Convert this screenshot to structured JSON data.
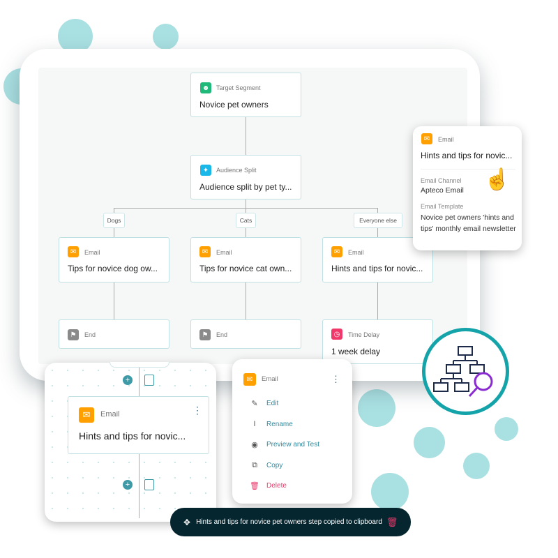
{
  "flow": {
    "target_segment": {
      "type": "Target Segment",
      "title": "Novice pet owners"
    },
    "audience_split": {
      "type": "Audience Split",
      "title": "Audience split by pet ty..."
    },
    "branches": [
      {
        "label": "Dogs",
        "email": {
          "type": "Email",
          "title": "Tips for novice dog ow..."
        },
        "next": {
          "type": "End",
          "title": ""
        }
      },
      {
        "label": "Cats",
        "email": {
          "type": "Email",
          "title": "Tips for novice cat own..."
        },
        "next": {
          "type": "End",
          "title": ""
        }
      },
      {
        "label": "Everyone else",
        "email": {
          "type": "Email",
          "title": "Hints and tips for novic..."
        },
        "next": {
          "type": "Time Delay",
          "title": "1 week delay"
        }
      }
    ]
  },
  "detail_card": {
    "type": "Email",
    "title": "Hints and tips for novic...",
    "channel_label": "Email Channel",
    "channel_value": "Apteco Email",
    "template_label": "Email Template",
    "template_value": "Novice pet owners 'hints and tips' monthly email newsletter"
  },
  "editor": {
    "node_type": "Email",
    "node_title": "Hints and tips for novic..."
  },
  "context_menu": {
    "header": "Email",
    "items": [
      {
        "label": "Edit",
        "icon": "edit-icon"
      },
      {
        "label": "Rename",
        "icon": "text-cursor-icon"
      },
      {
        "label": "Preview and Test",
        "icon": "eye-icon"
      },
      {
        "label": "Copy",
        "icon": "copy-icon"
      },
      {
        "label": "Delete",
        "icon": "trash-icon"
      }
    ]
  },
  "toast": {
    "message": "Hints and tips for novice pet owners step copied to clipboard"
  },
  "colors": {
    "email": "#ffa000",
    "segment": "#1fba7a",
    "split": "#19b8e8",
    "end": "#8a8a8a",
    "delay": "#f0386b",
    "accent": "#13a3a8",
    "toast": "#06262f",
    "delete": "#e8386b"
  }
}
